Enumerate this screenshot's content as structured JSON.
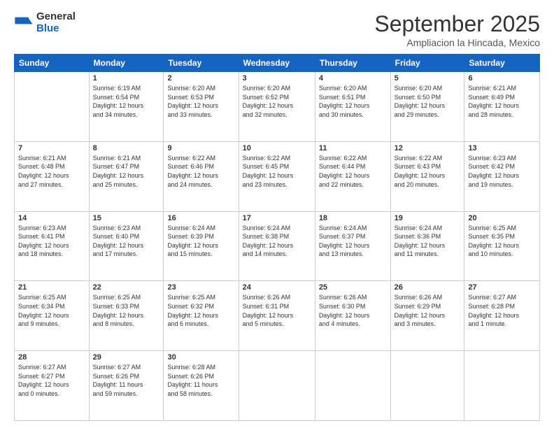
{
  "logo": {
    "general": "General",
    "blue": "Blue"
  },
  "title": "September 2025",
  "subtitle": "Ampliacion la Hincada, Mexico",
  "days_header": [
    "Sunday",
    "Monday",
    "Tuesday",
    "Wednesday",
    "Thursday",
    "Friday",
    "Saturday"
  ],
  "weeks": [
    [
      {
        "num": "",
        "content": ""
      },
      {
        "num": "1",
        "content": "Sunrise: 6:19 AM\nSunset: 6:54 PM\nDaylight: 12 hours\nand 34 minutes."
      },
      {
        "num": "2",
        "content": "Sunrise: 6:20 AM\nSunset: 6:53 PM\nDaylight: 12 hours\nand 33 minutes."
      },
      {
        "num": "3",
        "content": "Sunrise: 6:20 AM\nSunset: 6:52 PM\nDaylight: 12 hours\nand 32 minutes."
      },
      {
        "num": "4",
        "content": "Sunrise: 6:20 AM\nSunset: 6:51 PM\nDaylight: 12 hours\nand 30 minutes."
      },
      {
        "num": "5",
        "content": "Sunrise: 6:20 AM\nSunset: 6:50 PM\nDaylight: 12 hours\nand 29 minutes."
      },
      {
        "num": "6",
        "content": "Sunrise: 6:21 AM\nSunset: 6:49 PM\nDaylight: 12 hours\nand 28 minutes."
      }
    ],
    [
      {
        "num": "7",
        "content": "Sunrise: 6:21 AM\nSunset: 6:48 PM\nDaylight: 12 hours\nand 27 minutes."
      },
      {
        "num": "8",
        "content": "Sunrise: 6:21 AM\nSunset: 6:47 PM\nDaylight: 12 hours\nand 25 minutes."
      },
      {
        "num": "9",
        "content": "Sunrise: 6:22 AM\nSunset: 6:46 PM\nDaylight: 12 hours\nand 24 minutes."
      },
      {
        "num": "10",
        "content": "Sunrise: 6:22 AM\nSunset: 6:45 PM\nDaylight: 12 hours\nand 23 minutes."
      },
      {
        "num": "11",
        "content": "Sunrise: 6:22 AM\nSunset: 6:44 PM\nDaylight: 12 hours\nand 22 minutes."
      },
      {
        "num": "12",
        "content": "Sunrise: 6:22 AM\nSunset: 6:43 PM\nDaylight: 12 hours\nand 20 minutes."
      },
      {
        "num": "13",
        "content": "Sunrise: 6:23 AM\nSunset: 6:42 PM\nDaylight: 12 hours\nand 19 minutes."
      }
    ],
    [
      {
        "num": "14",
        "content": "Sunrise: 6:23 AM\nSunset: 6:41 PM\nDaylight: 12 hours\nand 18 minutes."
      },
      {
        "num": "15",
        "content": "Sunrise: 6:23 AM\nSunset: 6:40 PM\nDaylight: 12 hours\nand 17 minutes."
      },
      {
        "num": "16",
        "content": "Sunrise: 6:24 AM\nSunset: 6:39 PM\nDaylight: 12 hours\nand 15 minutes."
      },
      {
        "num": "17",
        "content": "Sunrise: 6:24 AM\nSunset: 6:38 PM\nDaylight: 12 hours\nand 14 minutes."
      },
      {
        "num": "18",
        "content": "Sunrise: 6:24 AM\nSunset: 6:37 PM\nDaylight: 12 hours\nand 13 minutes."
      },
      {
        "num": "19",
        "content": "Sunrise: 6:24 AM\nSunset: 6:36 PM\nDaylight: 12 hours\nand 11 minutes."
      },
      {
        "num": "20",
        "content": "Sunrise: 6:25 AM\nSunset: 6:35 PM\nDaylight: 12 hours\nand 10 minutes."
      }
    ],
    [
      {
        "num": "21",
        "content": "Sunrise: 6:25 AM\nSunset: 6:34 PM\nDaylight: 12 hours\nand 9 minutes."
      },
      {
        "num": "22",
        "content": "Sunrise: 6:25 AM\nSunset: 6:33 PM\nDaylight: 12 hours\nand 8 minutes."
      },
      {
        "num": "23",
        "content": "Sunrise: 6:25 AM\nSunset: 6:32 PM\nDaylight: 12 hours\nand 6 minutes."
      },
      {
        "num": "24",
        "content": "Sunrise: 6:26 AM\nSunset: 6:31 PM\nDaylight: 12 hours\nand 5 minutes."
      },
      {
        "num": "25",
        "content": "Sunrise: 6:26 AM\nSunset: 6:30 PM\nDaylight: 12 hours\nand 4 minutes."
      },
      {
        "num": "26",
        "content": "Sunrise: 6:26 AM\nSunset: 6:29 PM\nDaylight: 12 hours\nand 3 minutes."
      },
      {
        "num": "27",
        "content": "Sunrise: 6:27 AM\nSunset: 6:28 PM\nDaylight: 12 hours\nand 1 minute."
      }
    ],
    [
      {
        "num": "28",
        "content": "Sunrise: 6:27 AM\nSunset: 6:27 PM\nDaylight: 12 hours\nand 0 minutes."
      },
      {
        "num": "29",
        "content": "Sunrise: 6:27 AM\nSunset: 6:26 PM\nDaylight: 11 hours\nand 59 minutes."
      },
      {
        "num": "30",
        "content": "Sunrise: 6:28 AM\nSunset: 6:26 PM\nDaylight: 11 hours\nand 58 minutes."
      },
      {
        "num": "",
        "content": ""
      },
      {
        "num": "",
        "content": ""
      },
      {
        "num": "",
        "content": ""
      },
      {
        "num": "",
        "content": ""
      }
    ]
  ]
}
